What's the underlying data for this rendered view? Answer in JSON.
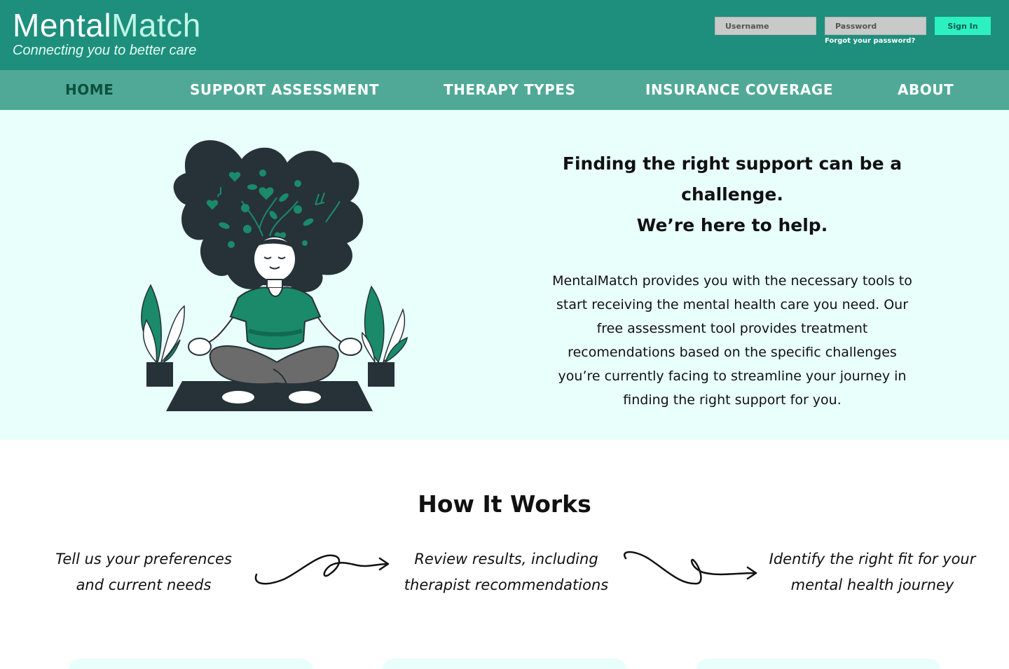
{
  "brand": {
    "name_part1": "Mental",
    "name_part2": "Match",
    "tagline": "Connecting you to better care"
  },
  "login": {
    "username_placeholder": "Username",
    "password_placeholder": "Password",
    "signin_label": "Sign In",
    "forgot_label": "Forgot your password?"
  },
  "nav": {
    "items": [
      {
        "label": "HOME",
        "active": true
      },
      {
        "label": "SUPPORT ASSESSMENT"
      },
      {
        "label": "THERAPY TYPES"
      },
      {
        "label": "INSURANCE COVERAGE"
      },
      {
        "label": "ABOUT"
      }
    ]
  },
  "hero": {
    "heading_line1": "Finding the right support can be a challenge.",
    "heading_line2": "We’re here to help.",
    "body": "MentalMatch provides you with the necessary tools to start receiving the mental health care you need. Our free assessment tool provides treatment recomendations based on the specific challenges you’re currently facing to streamline your journey in finding the right support for you.",
    "illustration_icon": "meditating-woman-illustration"
  },
  "how_it_works": {
    "title": "How It Works",
    "steps": [
      {
        "text": "Tell us your preferences and current needs"
      },
      {
        "text": "Review results, including therapist recommendations"
      },
      {
        "text": "Identify the right fit for your mental health journey"
      }
    ]
  },
  "colors": {
    "header": "#1d8f7c",
    "nav": "#50a997",
    "hero_bg": "#e8fffc",
    "signin": "#2cf0c0",
    "illustration_green": "#1a8a6a",
    "illustration_dark": "#263238"
  }
}
